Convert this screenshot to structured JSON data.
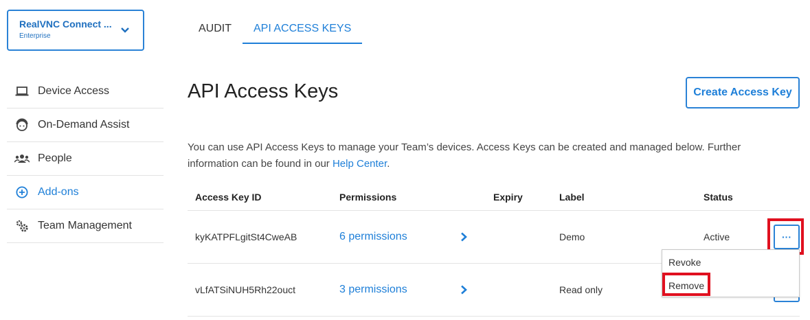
{
  "team": {
    "name": "RealVNC Connect ...",
    "plan": "Enterprise"
  },
  "sidebar": {
    "items": [
      {
        "label": "Device Access",
        "icon": "laptop-icon"
      },
      {
        "label": "On-Demand Assist",
        "icon": "support-agent-icon"
      },
      {
        "label": "People",
        "icon": "people-icon"
      },
      {
        "label": "Add-ons",
        "icon": "plus-circle-icon"
      },
      {
        "label": "Team Management",
        "icon": "gears-icon"
      }
    ]
  },
  "tabs": [
    {
      "label": "AUDIT",
      "active": false
    },
    {
      "label": "API ACCESS KEYS",
      "active": true
    }
  ],
  "page": {
    "title": "API Access Keys",
    "create_button": "Create Access Key",
    "description": "You can use API Access Keys to manage your Team’s devices. Access Keys can be created and managed below. Further information can be found in our ",
    "help_link": "Help Center",
    "description_end": "."
  },
  "table": {
    "headers": [
      "Access Key ID",
      "Permissions",
      "Expiry",
      "Label",
      "Status"
    ],
    "rows": [
      {
        "id": "kyKATPFLgitSt4CweAB",
        "permissions": "6 permissions",
        "expiry": "",
        "label": "Demo",
        "status": "Active"
      },
      {
        "id": "vLfATSiNUH5Rh22ouct",
        "permissions": "3 permissions",
        "expiry": "",
        "label": "Read only",
        "status": ""
      }
    ],
    "more_label": "···"
  },
  "menu": {
    "items": [
      "Revoke",
      "Remove"
    ]
  },
  "colors": {
    "accent": "#1e7fd8",
    "highlight": "#e0101f",
    "border": "#e3e3e3"
  }
}
